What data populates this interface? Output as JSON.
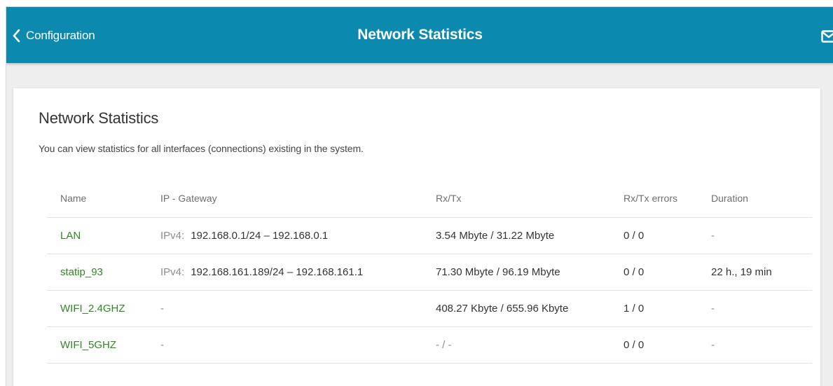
{
  "header": {
    "back_label": "Configuration",
    "title": "Network Statistics",
    "icons": {
      "back": "chevron-left-icon",
      "mail": "mail-icon"
    },
    "color": "#0b89ae"
  },
  "card": {
    "title": "Network Statistics",
    "description": "You can view statistics for all interfaces (connections) existing in the system."
  },
  "table": {
    "columns": [
      "Name",
      "IP - Gateway",
      "Rx/Tx",
      "Rx/Tx errors",
      "Duration"
    ],
    "rows": [
      {
        "name": "LAN",
        "ip_prefix": "IPv4:",
        "ip_gateway": "192.168.0.1/24 – 192.168.0.1",
        "rx_tx": "3.54 Mbyte / 31.22 Mbyte",
        "errors": "0 / 0",
        "duration": "-"
      },
      {
        "name": "statip_93",
        "ip_prefix": "IPv4:",
        "ip_gateway": "192.168.161.189/24 – 192.168.161.1",
        "rx_tx": "71.30 Mbyte / 96.19 Mbyte",
        "errors": "0 / 0",
        "duration": "22 h., 19 min"
      },
      {
        "name": "WIFI_2.4GHZ",
        "ip_prefix": "",
        "ip_gateway": "-",
        "rx_tx": "408.27 Kbyte / 655.96 Kbyte",
        "errors": "1 / 0",
        "duration": "-"
      },
      {
        "name": "WIFI_5GHZ",
        "ip_prefix": "",
        "ip_gateway": "-",
        "rx_tx": "- / -",
        "errors": "0 / 0",
        "duration": "-"
      }
    ]
  },
  "colors": {
    "accent": "#0b89ae",
    "link": "#2c8a1e"
  }
}
